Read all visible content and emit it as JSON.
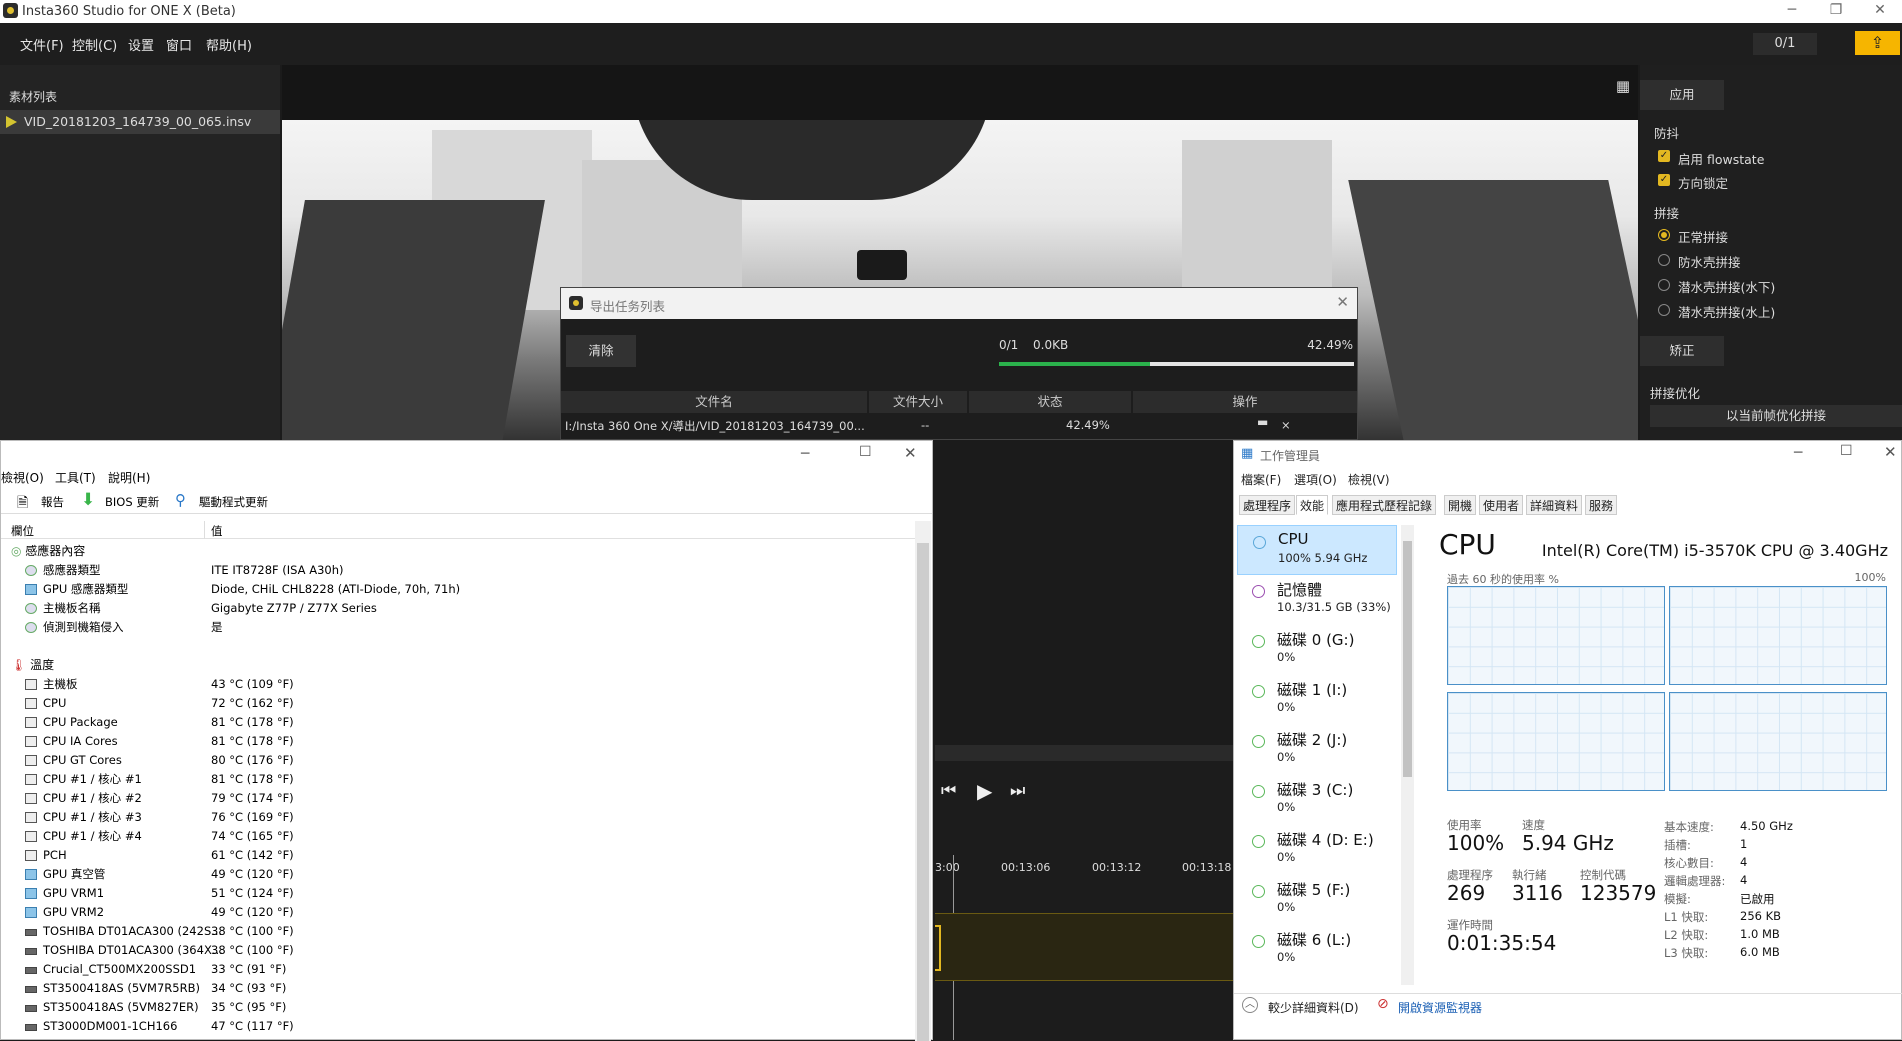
{
  "insta": {
    "title": "Insta360 Studio for ONE X (Beta)",
    "menu": [
      "文件(F)",
      "控制(C)",
      "设置",
      "窗口",
      "帮助(H)"
    ],
    "counter": "0/1",
    "export_icon": "upload-icon",
    "library": {
      "header": "素材列表",
      "file": "VID_20181203_164739_00_065.insv"
    },
    "right": {
      "apply": "应用",
      "stab_title": "防抖",
      "flowstate": "启用 flowstate",
      "dir_lock": "方向锁定",
      "stitch_title": "拼接",
      "stitch_opts": [
        "正常拼接",
        "防水壳拼接",
        "潜水壳拼接(水下)",
        "潜水壳拼接(水上)"
      ],
      "correct": "矫正",
      "opt_title": "拼接优化",
      "opt_btn": "以当前帧优化拼接"
    },
    "timeline": {
      "times": [
        "3:00",
        "00:13:06",
        "00:13:12",
        "00:13:18"
      ]
    }
  },
  "export": {
    "title": "导出任务列表",
    "clear": "清除",
    "count": "0/1",
    "size": "0.0KB",
    "percent": "42.49%",
    "progress": 0.4249,
    "cols": [
      "文件名",
      "文件大小",
      "状态",
      "操作"
    ],
    "row": {
      "file": "I:/Insta 360 One X/導出/VID_20181203_164739_00...",
      "size": "--",
      "status": "42.49%",
      "close": "×"
    }
  },
  "hwinfo": {
    "menu": [
      "檢視(O)",
      "工具(T)",
      "說明(H)"
    ],
    "toolbar": [
      "報告",
      "BIOS 更新",
      "驅動程式更新"
    ],
    "cols": [
      "欄位",
      "值"
    ],
    "group1": "感應器內容",
    "group1_rows": [
      [
        "感應器類型",
        "ITE IT8728F  (ISA A30h)"
      ],
      [
        "GPU 感應器類型",
        "Diode, CHiL CHL8228  (ATI-Diode, 70h, 71h)"
      ],
      [
        "主機板名稱",
        "Gigabyte Z77P / Z77X Series"
      ],
      [
        "偵測到機箱侵入",
        "是"
      ]
    ],
    "group2": "溫度",
    "group2_rows": [
      [
        "主機板",
        "43 °C  (109 °F)"
      ],
      [
        "CPU",
        "72 °C  (162 °F)"
      ],
      [
        "CPU Package",
        "81 °C  (178 °F)"
      ],
      [
        "CPU IA Cores",
        "81 °C  (178 °F)"
      ],
      [
        "CPU GT Cores",
        "80 °C  (176 °F)"
      ],
      [
        "CPU #1 / 核心 #1",
        "81 °C  (178 °F)"
      ],
      [
        "CPU #1 / 核心 #2",
        "79 °C  (174 °F)"
      ],
      [
        "CPU #1 / 核心 #3",
        "76 °C  (169 °F)"
      ],
      [
        "CPU #1 / 核心 #4",
        "74 °C  (165 °F)"
      ],
      [
        "PCH",
        "61 °C  (142 °F)"
      ],
      [
        "GPU 真空管",
        "49 °C  (120 °F)"
      ],
      [
        "GPU VRM1",
        "51 °C  (124 °F)"
      ],
      [
        "GPU VRM2",
        "49 °C  (120 °F)"
      ],
      [
        "TOSHIBA DT01ACA300 (242S...",
        "38 °C  (100 °F)"
      ],
      [
        "TOSHIBA DT01ACA300 (364X...",
        "38 °C  (100 °F)"
      ],
      [
        "Crucial_CT500MX200SSD1",
        "33 °C  (91 °F)"
      ],
      [
        "ST3500418AS (5VM7R5RB)",
        "34 °C  (93 °F)"
      ],
      [
        "ST3500418AS (5VM827ER)",
        "35 °C  (95 °F)"
      ],
      [
        "ST3000DM001-1CH166",
        "47 °C  (117 °F)"
      ]
    ]
  },
  "taskmgr": {
    "title": "工作管理員",
    "menu": [
      "檔案(F)",
      "選項(O)",
      "檢視(V)"
    ],
    "tabs": [
      "處理程序",
      "效能",
      "應用程式歷程記錄",
      "開機",
      "使用者",
      "詳細資料",
      "服務"
    ],
    "list": [
      [
        "CPU",
        "100%  5.94 GHz"
      ],
      [
        "記憶體",
        "10.3/31.5 GB (33%)"
      ],
      [
        "磁碟 0 (G:)",
        "0%"
      ],
      [
        "磁碟 1 (I:)",
        "0%"
      ],
      [
        "磁碟 2 (J:)",
        "0%"
      ],
      [
        "磁碟 3 (C:)",
        "0%"
      ],
      [
        "磁碟 4 (D: E:)",
        "0%"
      ],
      [
        "磁碟 5 (F:)",
        "0%"
      ],
      [
        "磁碟 6 (L:)",
        "0%"
      ]
    ],
    "cpu_title": "CPU",
    "cpu_name": "Intel(R) Core(TM) i5-3570K CPU @ 3.40GHz",
    "graph_label": "過去 60 秒的使用率 %",
    "graph_max": "100%",
    "stats": {
      "util_l": "使用率",
      "util": "100%",
      "speed_l": "速度",
      "speed": "5.94 GHz",
      "proc_l": "處理程序",
      "proc": "269",
      "thr_l": "執行緒",
      "thr": "3116",
      "hdl_l": "控制代碼",
      "hdl": "123579",
      "up_l": "運作時間",
      "up": "0:01:35:54"
    },
    "kv": [
      [
        "基本速度:",
        "4.50 GHz"
      ],
      [
        "插槽:",
        "1"
      ],
      [
        "核心數目:",
        "4"
      ],
      [
        "邏輯處理器:",
        "4"
      ],
      [
        "模擬:",
        "已啟用"
      ],
      [
        "L1 快取:",
        "256 KB"
      ],
      [
        "L2 快取:",
        "1.0 MB"
      ],
      [
        "L3 快取:",
        "6.0 MB"
      ]
    ],
    "fewer": "較少詳細資料(D)",
    "resmon": "開啟資源監視器"
  }
}
